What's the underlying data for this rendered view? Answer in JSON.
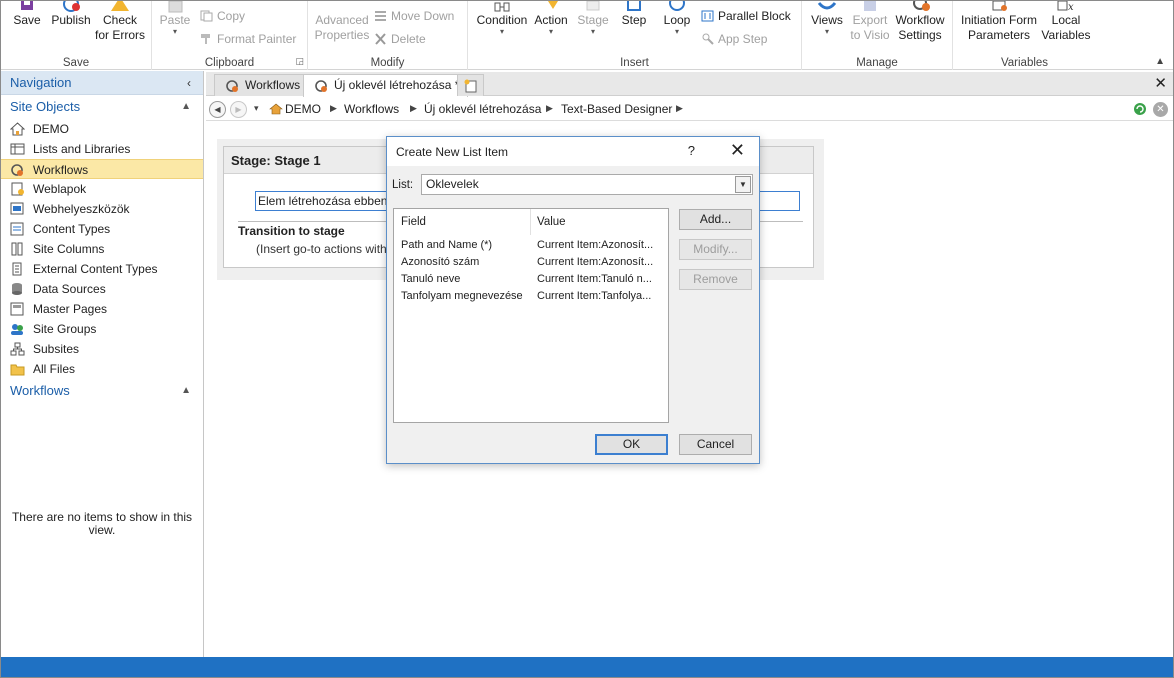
{
  "ribbon": {
    "save": {
      "items": {
        "save": "Save",
        "publish": "Publish",
        "check_line1": "Check",
        "check_line2": "for Errors"
      },
      "label": "Save"
    },
    "clipboard": {
      "paste": "Paste",
      "copy": "Copy",
      "format_painter": "Format Painter",
      "label": "Clipboard"
    },
    "modify": {
      "adv_line1": "Advanced",
      "adv_line2": "Properties",
      "move_down": "Move Down",
      "delete": "Delete",
      "label": "Modify"
    },
    "insert": {
      "condition": "Condition",
      "action": "Action",
      "stage": "Stage",
      "step": "Step",
      "loop": "Loop",
      "parallel_block": "Parallel Block",
      "app_step": "App Step",
      "label": "Insert"
    },
    "manage": {
      "views": "Views",
      "export_line1": "Export",
      "export_line2": "to Visio",
      "wfs_line1": "Workflow",
      "wfs_line2": "Settings",
      "label": "Manage"
    },
    "variables": {
      "init_line1": "Initiation Form",
      "init_line2": "Parameters",
      "local_line1": "Local",
      "local_line2": "Variables",
      "label": "Variables"
    }
  },
  "nav": {
    "header": "Navigation",
    "site_objects": "Site Objects",
    "items": [
      {
        "label": "DEMO",
        "icon": "home-icon"
      },
      {
        "label": "Lists and Libraries",
        "icon": "list-icon"
      },
      {
        "label": "Workflows",
        "icon": "workflow-icon"
      },
      {
        "label": "Weblapok",
        "icon": "page-icon"
      },
      {
        "label": "Webhelyeszközök",
        "icon": "site-tools-icon"
      },
      {
        "label": "Content Types",
        "icon": "content-type-icon"
      },
      {
        "label": "Site Columns",
        "icon": "columns-icon"
      },
      {
        "label": "External Content Types",
        "icon": "external-icon"
      },
      {
        "label": "Data Sources",
        "icon": "database-icon"
      },
      {
        "label": "Master Pages",
        "icon": "master-page-icon"
      },
      {
        "label": "Site Groups",
        "icon": "group-icon"
      },
      {
        "label": "Subsites",
        "icon": "subsites-icon"
      },
      {
        "label": "All Files",
        "icon": "folder-icon"
      }
    ],
    "workflows_section": "Workflows",
    "empty_text": "There are no items to show in this view."
  },
  "tabs": [
    {
      "label": "Workflows"
    },
    {
      "label": "Új oklevél létrehozása *"
    }
  ],
  "breadcrumb": [
    "DEMO",
    "Workflows",
    "Új oklevél létrehozása",
    "Text-Based Designer"
  ],
  "stage": {
    "title": "Stage: Stage 1",
    "action_text": "Elem létrehozása ebben: Oklevelek",
    "transition_title": "Transition to stage",
    "transition_hint": "(Insert go-to actions with conditions for transitioning to the stage)"
  },
  "dialog": {
    "title": "Create New List Item",
    "help": "?",
    "list_label": "List:",
    "list_value": "Oklevelek",
    "columns": {
      "field": "Field",
      "value": "Value"
    },
    "rows": [
      {
        "field": "Path and Name (*)",
        "value": "Current Item:Azonosít..."
      },
      {
        "field": "Azonosító szám",
        "value": "Current Item:Azonosít..."
      },
      {
        "field": "Tanuló neve",
        "value": "Current Item:Tanuló n..."
      },
      {
        "field": "Tanfolyam megnevezése",
        "value": "Current Item:Tanfolya..."
      }
    ],
    "buttons": {
      "add": "Add...",
      "modify": "Modify...",
      "remove": "Remove",
      "ok": "OK",
      "cancel": "Cancel"
    }
  },
  "colors": {
    "accent": "#1f71c3",
    "selection": "#fbe8a6",
    "nav_header": "#dbe7f3"
  }
}
